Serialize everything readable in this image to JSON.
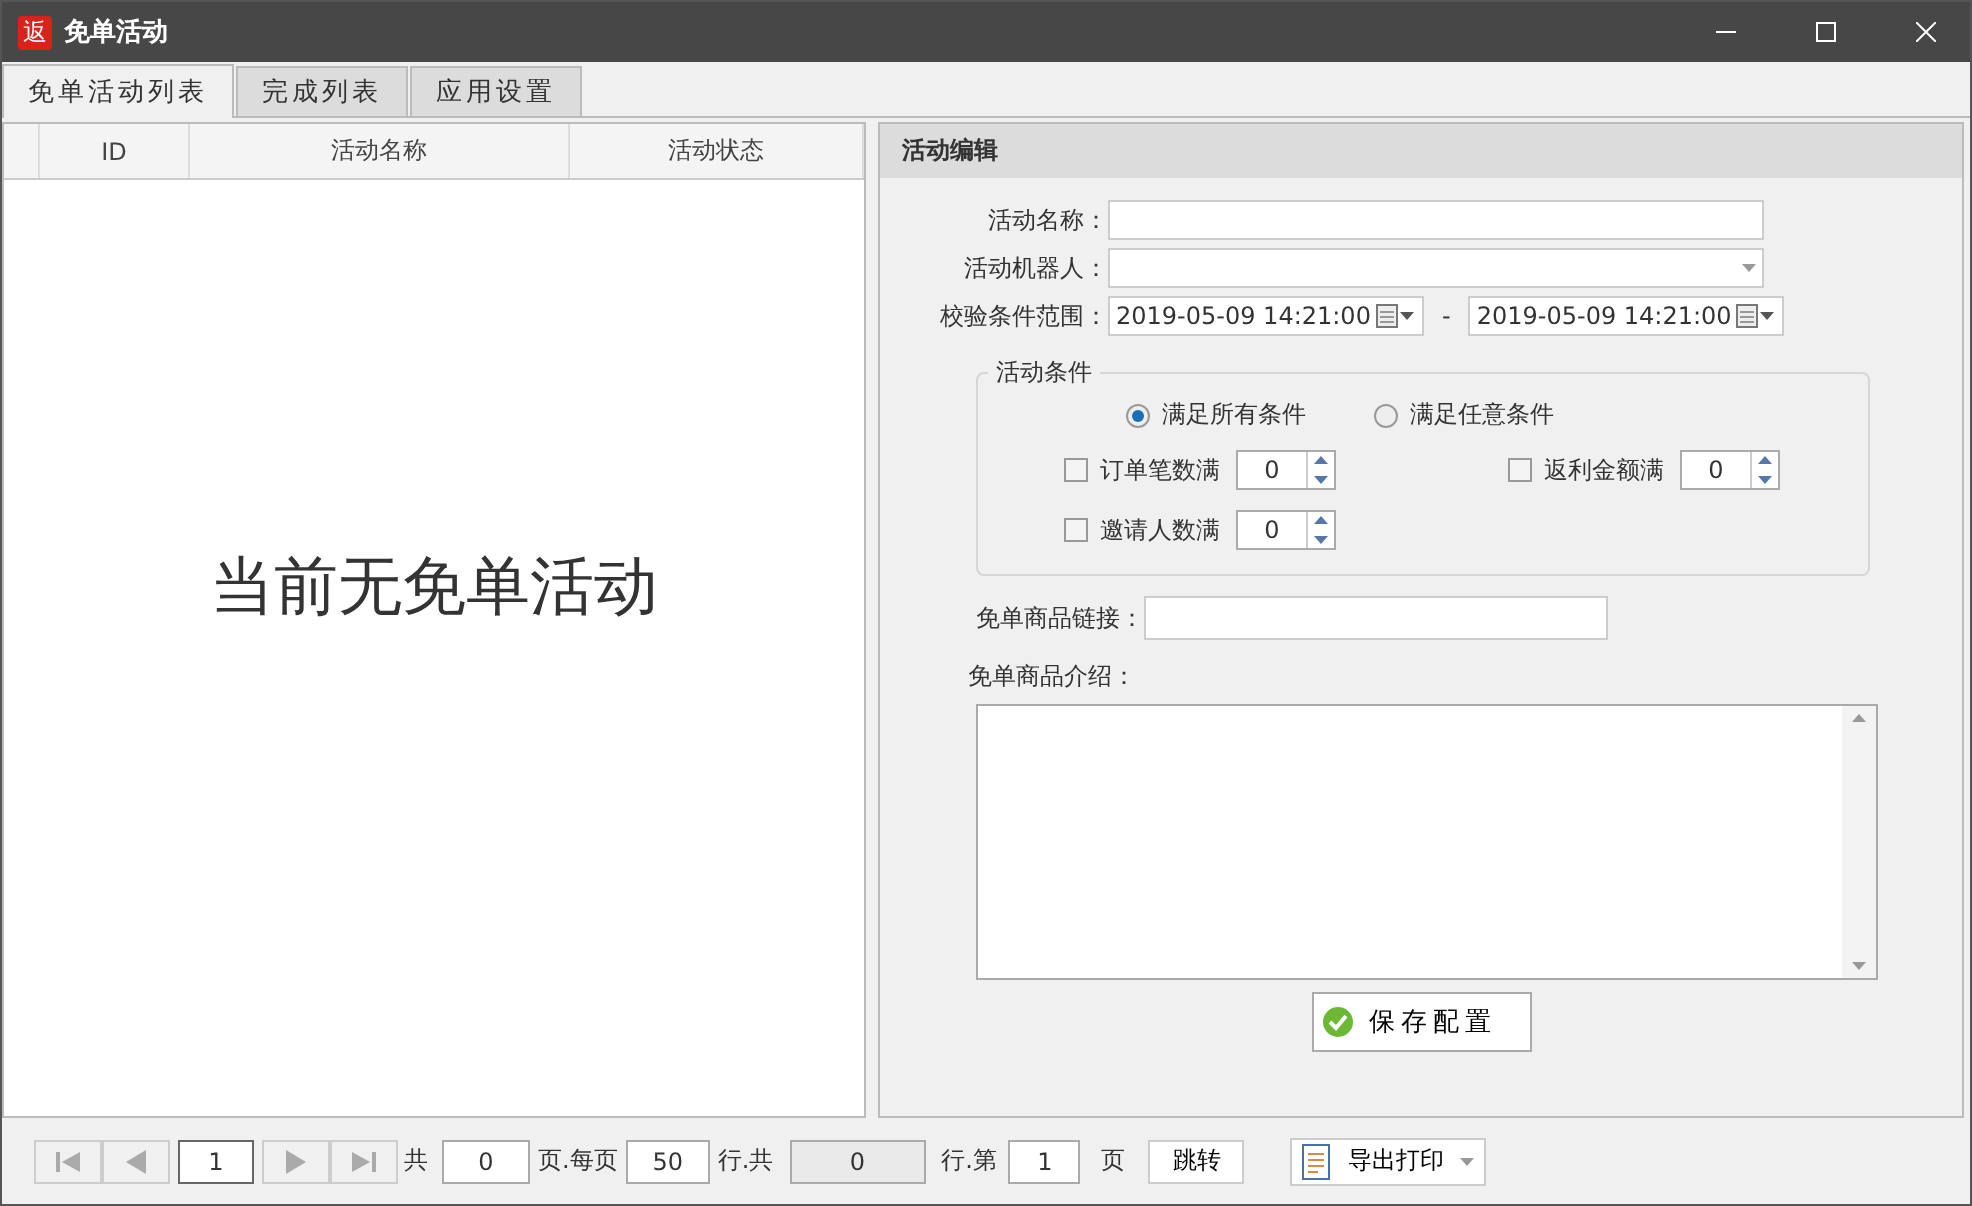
{
  "window": {
    "logo": "返",
    "title": "免单活动"
  },
  "tabs": [
    {
      "label": "免单活动列表",
      "selected": true
    },
    {
      "label": "完成列表",
      "selected": false
    },
    {
      "label": "应用设置",
      "selected": false
    }
  ],
  "table": {
    "columns": [
      "ID",
      "活动名称",
      "活动状态"
    ],
    "empty_message": "当前无免单活动"
  },
  "editor": {
    "title": "活动编辑",
    "name_label": "活动名称：",
    "robot_label": "活动机器人：",
    "range_label": "校验条件范围：",
    "range_start": "2019-05-09 14:21:00",
    "range_separator": "-",
    "range_end": "2019-05-09 14:21:00",
    "conditions": {
      "legend": "活动条件",
      "modes": [
        {
          "label": "满足所有条件",
          "selected": true
        },
        {
          "label": "满足任意条件",
          "selected": false
        }
      ],
      "rules": [
        {
          "label": "订单笔数满",
          "checked": false,
          "value": "0"
        },
        {
          "label": "返利金额满",
          "checked": false,
          "value": "0"
        },
        {
          "label": "邀请人数满",
          "checked": false,
          "value": "0"
        }
      ]
    },
    "link_label": "免单商品链接：",
    "intro_label": "免单商品介绍：",
    "save_button": "保存配置"
  },
  "pager": {
    "page": "1",
    "total_label": "共",
    "total_pages": "0",
    "per_page_label": "页.每页",
    "per_page": "50",
    "rows_label": "行.共",
    "total_rows": "0",
    "goto_label": "行.第",
    "goto_page": "1",
    "page_label": "页",
    "jump_button": "跳转",
    "export_button": "导出打印"
  }
}
